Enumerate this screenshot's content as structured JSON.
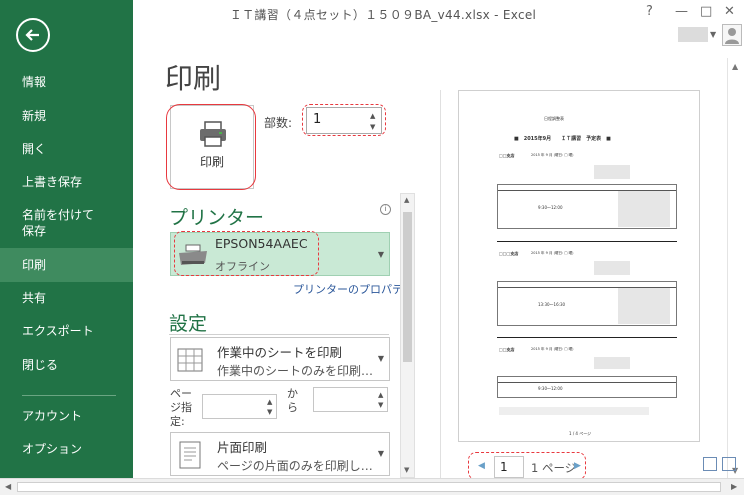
{
  "window": {
    "title": "ＩＴ講習（４点セット）１５０９BA_v44.xlsx - Excel",
    "help": "?",
    "minimize": "—",
    "restore": "□",
    "close": "✕"
  },
  "sidebar": {
    "items": [
      {
        "label": "情報"
      },
      {
        "label": "新規"
      },
      {
        "label": "開く"
      },
      {
        "label": "上書き保存"
      },
      {
        "label": "名前を付けて\n保存"
      },
      {
        "label": "印刷"
      },
      {
        "label": "共有"
      },
      {
        "label": "エクスポート"
      },
      {
        "label": "閉じる"
      },
      {
        "label": "アカウント"
      },
      {
        "label": "オプション"
      }
    ]
  },
  "print": {
    "title": "印刷",
    "button_label": "印刷",
    "copies_label": "部数:",
    "copies_value": "1"
  },
  "printer": {
    "heading": "プリンター",
    "name": "EPSON54AAEC",
    "status": "オフライン",
    "properties_link": "プリンターのプロパティ"
  },
  "settings": {
    "heading": "設定",
    "sheet_title": "作業中のシートを印刷",
    "sheet_sub": "作業中のシートのみを印刷…",
    "pages_label": "ページ指定:",
    "from_label": "から",
    "sides_title": "片面印刷",
    "sides_sub": "ページの片面のみを印刷し…"
  },
  "preview": {
    "doc_title": "日程調整表",
    "header_line": "■　2015年9月　　ＩＴ講習　予定表　■",
    "sections": [
      {
        "name": "□□支店",
        "date": "2015 年 9 月 (曜日: □ 曜)"
      },
      {
        "name": "□□□支店",
        "date": "2015 年 9 月 (曜日: □ 曜)"
      },
      {
        "name": "□□支店",
        "date": "2015 年 9 月 (曜日: □ 曜)"
      }
    ],
    "times": [
      "9:30〜12:00",
      "13:30〜16:30",
      "9:30〜12:00"
    ],
    "footer": "1 / 4 ページ",
    "current_page": "1",
    "total_pages": "1 ページ"
  },
  "colors": {
    "sidebar": "#217346",
    "sidebar_active": "#3f8b5f",
    "accent": "#217346",
    "highlight": "#e8393f"
  }
}
